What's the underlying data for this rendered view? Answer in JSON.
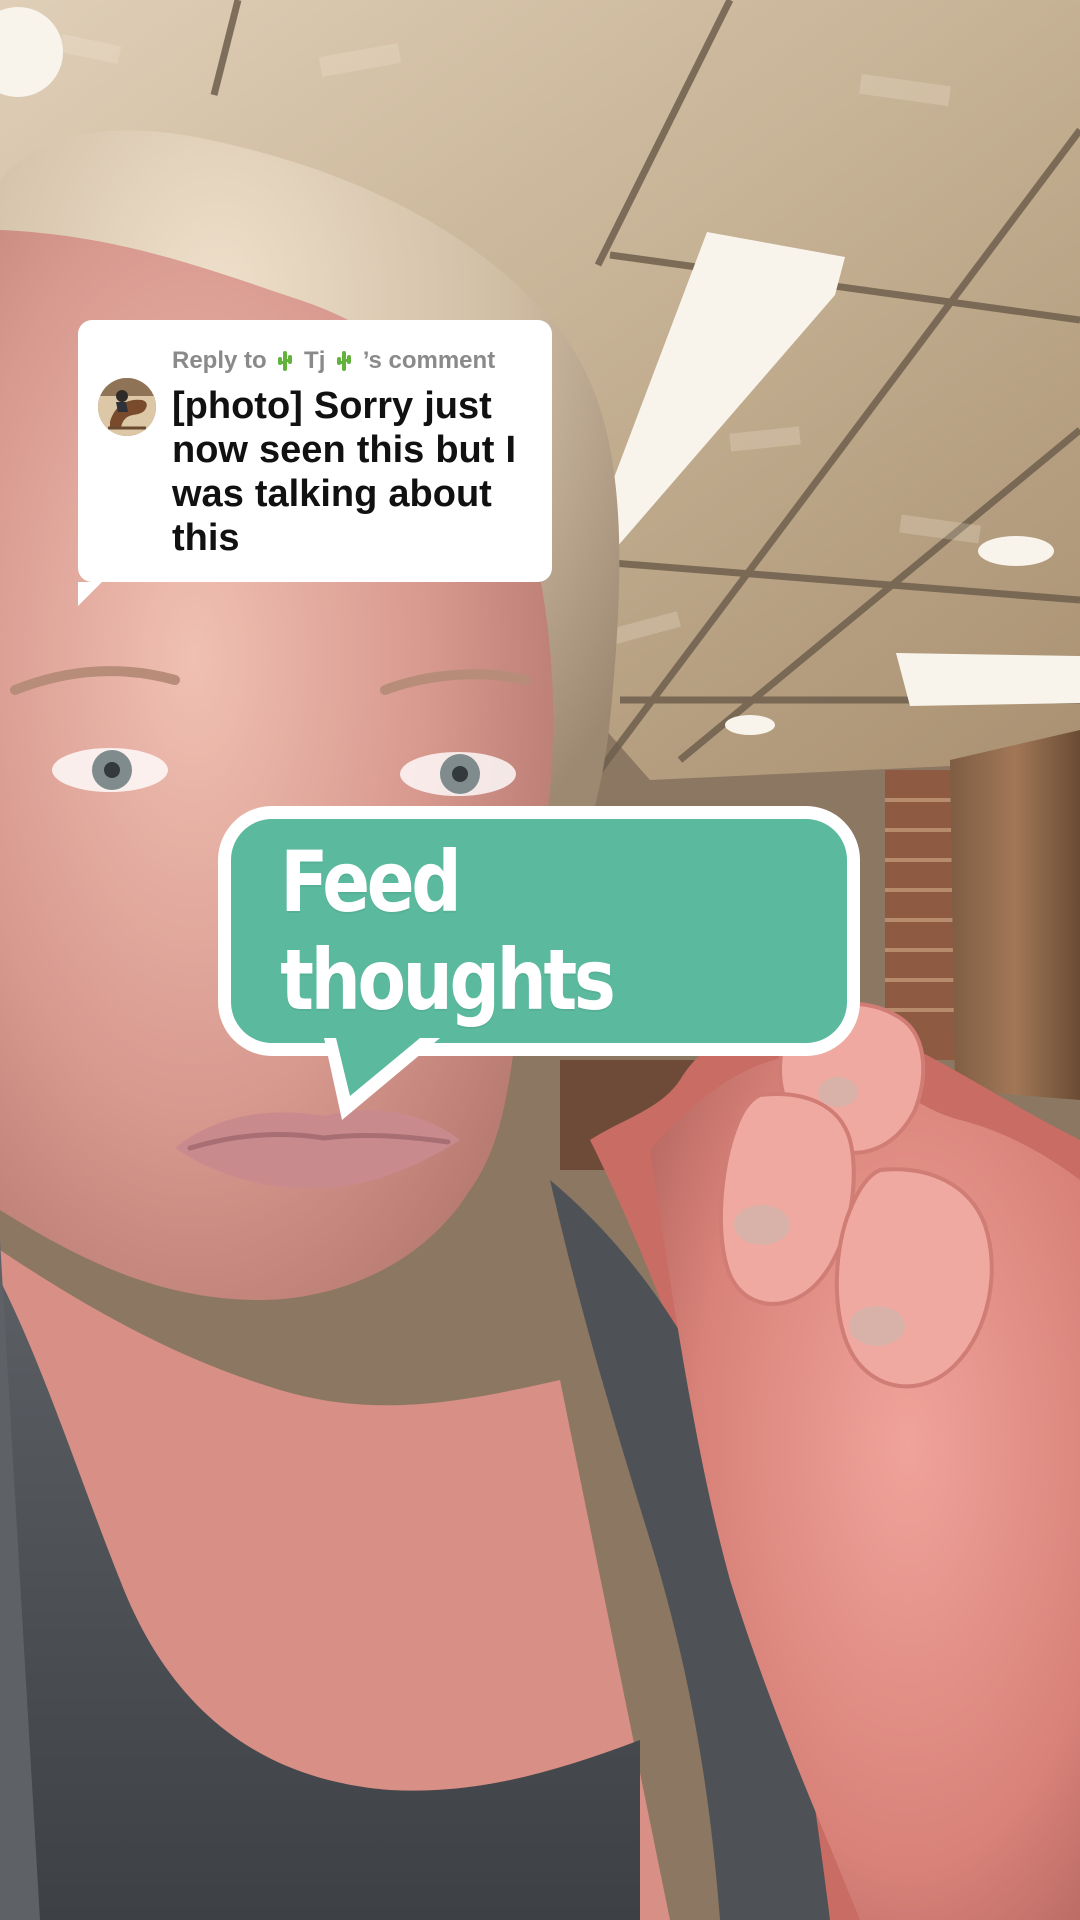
{
  "reply": {
    "prefix": "Reply to",
    "username": "Tj",
    "suffix": "’s comment",
    "body": "[photo] Sorry just now seen this but I was talking about this",
    "accent_color": "#8a8a8a"
  },
  "sticker": {
    "text": "Feed thoughts",
    "background_color": "#5bba9e",
    "border_color": "#ffffff"
  },
  "icons": {
    "username_left": "cactus-icon",
    "username_right": "cactus-icon"
  }
}
